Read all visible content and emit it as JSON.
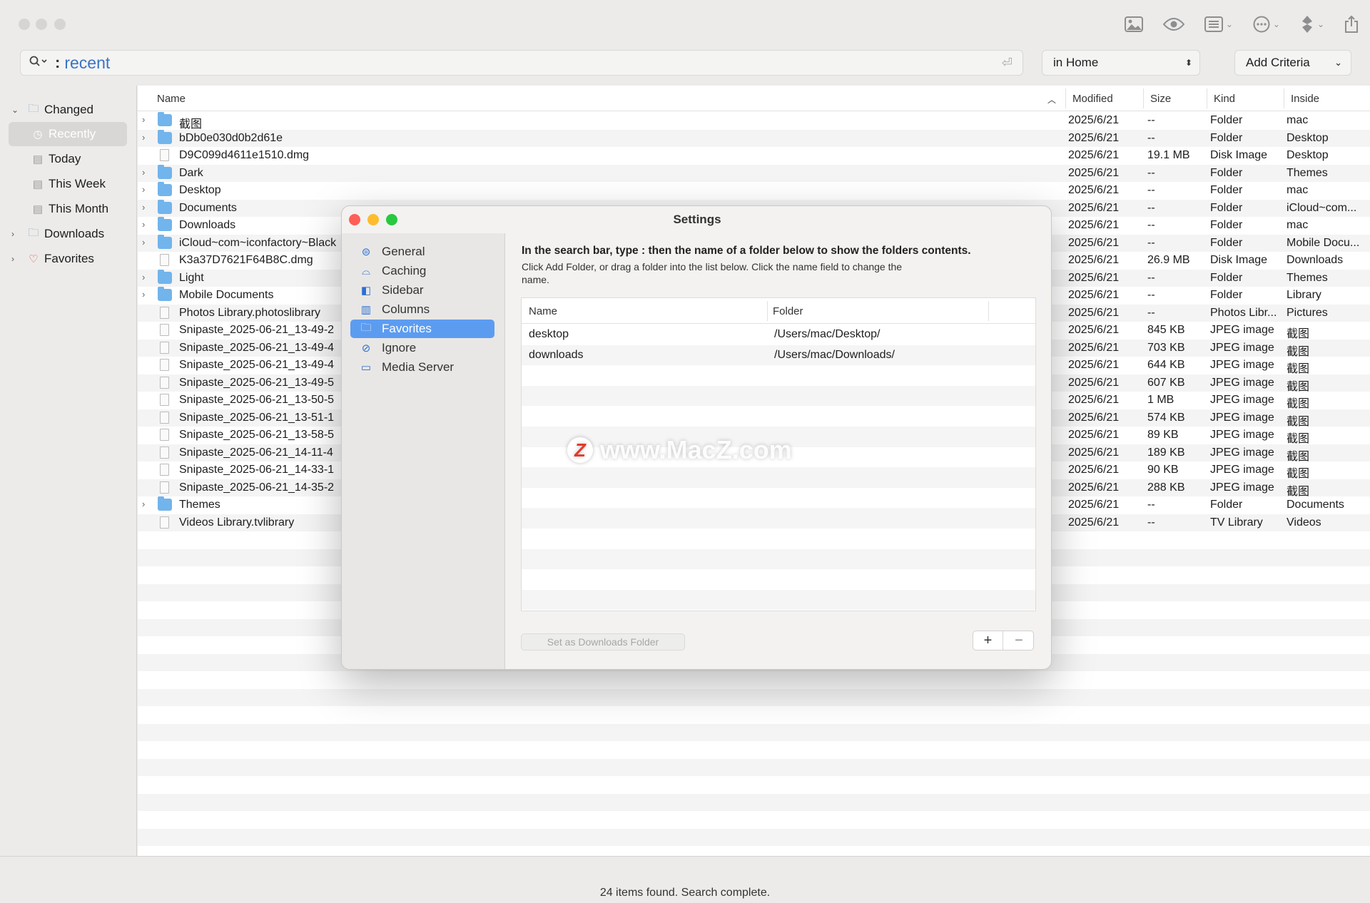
{
  "toolbar": {
    "search_query": "recent",
    "search_colon": ":",
    "scope_label": "in Home",
    "add_criteria_label": "Add Criteria",
    "icons": [
      "image-icon",
      "eye-icon",
      "list-view-icon",
      "more-icon",
      "share-icon"
    ]
  },
  "sidebar": {
    "items": [
      {
        "label": "Changed",
        "icon": "folder-icon"
      },
      {
        "label": "Recently",
        "icon": "clock-icon"
      },
      {
        "label": "Today",
        "icon": "calendar-icon"
      },
      {
        "label": "This Week",
        "icon": "calendar-icon"
      },
      {
        "label": "This Month",
        "icon": "calendar-icon"
      },
      {
        "label": "Downloads",
        "icon": "folder-icon"
      },
      {
        "label": "Favorites",
        "icon": "heart-icon"
      }
    ]
  },
  "columns": {
    "name": "Name",
    "modified": "Modified",
    "size": "Size",
    "kind": "Kind",
    "inside": "Inside"
  },
  "files": [
    {
      "name": "截图",
      "modified": "2025/6/21",
      "size": "--",
      "kind": "Folder",
      "inside": "mac"
    },
    {
      "name": "bDb0e030d0b2d61e",
      "modified": "2025/6/21",
      "size": "--",
      "kind": "Folder",
      "inside": "Desktop"
    },
    {
      "name": "D9C099d4611e1510.dmg",
      "modified": "2025/6/21",
      "size": "19.1 MB",
      "kind": "Disk Image",
      "inside": "Desktop"
    },
    {
      "name": "Dark",
      "modified": "2025/6/21",
      "size": "--",
      "kind": "Folder",
      "inside": "Themes"
    },
    {
      "name": "Desktop",
      "modified": "2025/6/21",
      "size": "--",
      "kind": "Folder",
      "inside": "mac"
    },
    {
      "name": "Documents",
      "modified": "2025/6/21",
      "size": "--",
      "kind": "Folder",
      "inside": "iCloud~com..."
    },
    {
      "name": "Downloads",
      "modified": "2025/6/21",
      "size": "--",
      "kind": "Folder",
      "inside": "mac"
    },
    {
      "name": "iCloud~com~iconfactory~Black",
      "modified": "2025/6/21",
      "size": "--",
      "kind": "Folder",
      "inside": "Mobile Docu..."
    },
    {
      "name": "K3a37D7621F64B8C.dmg",
      "modified": "2025/6/21",
      "size": "26.9 MB",
      "kind": "Disk Image",
      "inside": "Downloads"
    },
    {
      "name": "Light",
      "modified": "2025/6/21",
      "size": "--",
      "kind": "Folder",
      "inside": "Themes"
    },
    {
      "name": "Mobile Documents",
      "modified": "2025/6/21",
      "size": "--",
      "kind": "Folder",
      "inside": "Library"
    },
    {
      "name": "Photos Library.photoslibrary",
      "modified": "2025/6/21",
      "size": "--",
      "kind": "Photos Libr...",
      "inside": "Pictures"
    },
    {
      "name": "Snipaste_2025-06-21_13-49-2",
      "modified": "2025/6/21",
      "size": "845 KB",
      "kind": "JPEG image",
      "inside": "截图"
    },
    {
      "name": "Snipaste_2025-06-21_13-49-4",
      "modified": "2025/6/21",
      "size": "703 KB",
      "kind": "JPEG image",
      "inside": "截图"
    },
    {
      "name": "Snipaste_2025-06-21_13-49-4",
      "modified": "2025/6/21",
      "size": "644 KB",
      "kind": "JPEG image",
      "inside": "截图"
    },
    {
      "name": "Snipaste_2025-06-21_13-49-5",
      "modified": "2025/6/21",
      "size": "607 KB",
      "kind": "JPEG image",
      "inside": "截图"
    },
    {
      "name": "Snipaste_2025-06-21_13-50-5",
      "modified": "2025/6/21",
      "size": "1 MB",
      "kind": "JPEG image",
      "inside": "截图"
    },
    {
      "name": "Snipaste_2025-06-21_13-51-1",
      "modified": "2025/6/21",
      "size": "574 KB",
      "kind": "JPEG image",
      "inside": "截图"
    },
    {
      "name": "Snipaste_2025-06-21_13-58-5",
      "modified": "2025/6/21",
      "size": "89 KB",
      "kind": "JPEG image",
      "inside": "截图"
    },
    {
      "name": "Snipaste_2025-06-21_14-11-4",
      "modified": "2025/6/21",
      "size": "189 KB",
      "kind": "JPEG image",
      "inside": "截图"
    },
    {
      "name": "Snipaste_2025-06-21_14-33-1",
      "modified": "2025/6/21",
      "size": "90 KB",
      "kind": "JPEG image",
      "inside": "截图"
    },
    {
      "name": "Snipaste_2025-06-21_14-35-2",
      "modified": "2025/6/21",
      "size": "288 KB",
      "kind": "JPEG image",
      "inside": "截图"
    },
    {
      "name": "Themes",
      "modified": "2025/6/21",
      "size": "--",
      "kind": "Folder",
      "inside": "Documents"
    },
    {
      "name": "Videos Library.tvlibrary",
      "modified": "2025/6/21",
      "size": "--",
      "kind": "TV Library",
      "inside": "Videos"
    }
  ],
  "status": "24 items found. Search complete.",
  "settings": {
    "title": "Settings",
    "nav": [
      {
        "label": "General",
        "icon": "toggles-icon"
      },
      {
        "label": "Caching",
        "icon": "cache-icon"
      },
      {
        "label": "Sidebar",
        "icon": "sidebar-icon"
      },
      {
        "label": "Columns",
        "icon": "columns-icon"
      },
      {
        "label": "Favorites",
        "icon": "folder-icon"
      },
      {
        "label": "Ignore",
        "icon": "prohibit-icon"
      },
      {
        "label": "Media Server",
        "icon": "display-icon"
      }
    ],
    "heading": "In the search bar, type : then the name of a folder below to show the folders contents.",
    "subtext": "Click Add Folder, or drag a folder into the list below. Click the name field to change the name.",
    "table_headers": {
      "name": "Name",
      "folder": "Folder"
    },
    "favorites": [
      {
        "name": "desktop",
        "folder": "/Users/mac/Desktop/"
      },
      {
        "name": "downloads",
        "folder": "/Users/mac/Downloads/"
      }
    ],
    "set_downloads_label": "Set as Downloads Folder",
    "add_label": "+",
    "remove_label": "−"
  },
  "watermark": {
    "logo": "Z",
    "text": "www.MacZ.com"
  },
  "colors": {
    "accent": "#5c9cf0",
    "folder": "#72b4ec",
    "query": "#3a73c7"
  }
}
